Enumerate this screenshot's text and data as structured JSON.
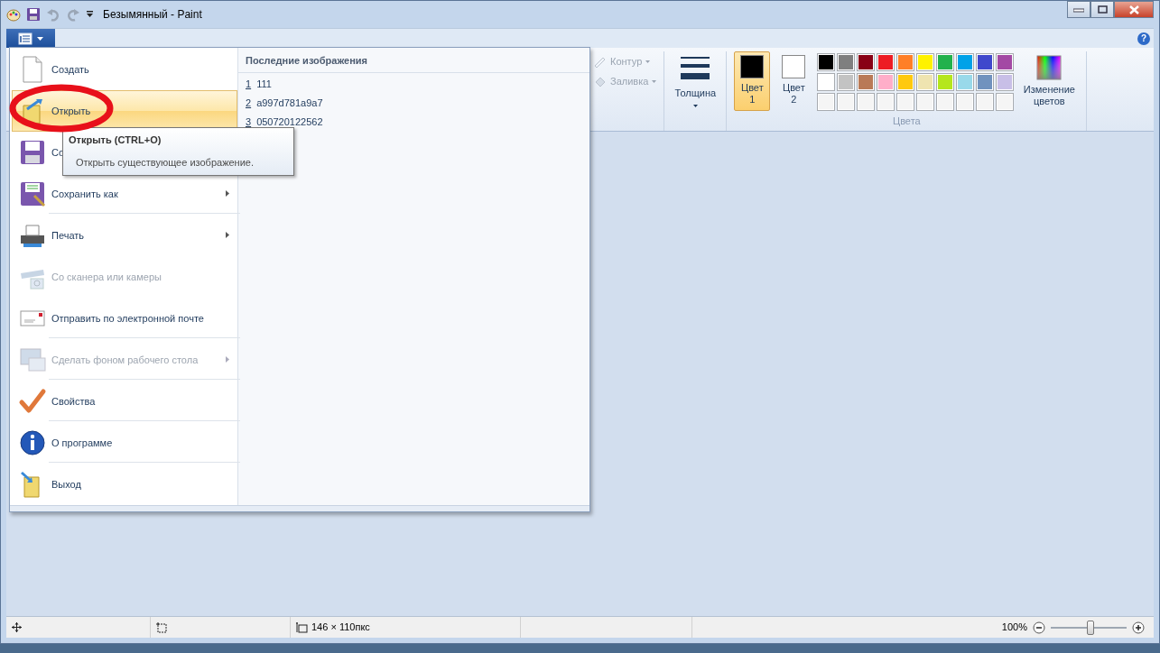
{
  "window": {
    "title": "Безымянный - Paint"
  },
  "app_menu": {
    "items": [
      {
        "label": "Создать",
        "selected": false,
        "disabled": false,
        "submenu": false,
        "separator_after": false
      },
      {
        "label": "Открыть",
        "selected": true,
        "disabled": false,
        "submenu": false,
        "separator_after": false
      },
      {
        "label": "Со",
        "selected": false,
        "disabled": false,
        "separator_after": false
      },
      {
        "label": "Сохранить как",
        "selected": false,
        "disabled": false,
        "submenu": true,
        "separator_after": true
      },
      {
        "label": "Печать",
        "selected": false,
        "disabled": false,
        "submenu": true,
        "separator_after": false
      },
      {
        "label": "Со сканера или камеры",
        "selected": false,
        "disabled": true,
        "submenu": false,
        "separator_after": false
      },
      {
        "label": "Отправить по электронной почте",
        "selected": false,
        "disabled": false,
        "submenu": false,
        "separator_after": true
      },
      {
        "label": "Сделать фоном рабочего стола",
        "selected": false,
        "disabled": true,
        "submenu": true,
        "separator_after": true
      },
      {
        "label": "Свойства",
        "selected": false,
        "disabled": false,
        "submenu": false,
        "separator_after": true
      },
      {
        "label": "О программе",
        "selected": false,
        "disabled": false,
        "submenu": false,
        "separator_after": true
      },
      {
        "label": "Выход",
        "selected": false,
        "disabled": false,
        "submenu": false,
        "separator_after": false
      }
    ],
    "recent": {
      "title": "Последние изображения",
      "items": [
        {
          "number": "1",
          "name": "111"
        },
        {
          "number": "2",
          "name": "a997d781a9a7"
        },
        {
          "number": "3",
          "name": "050720122562"
        }
      ]
    }
  },
  "tooltip": {
    "title": "Открыть (CTRL+O)",
    "text": "Открыть существующее изображение."
  },
  "ribbon": {
    "outline": {
      "label": "Контур",
      "disabled": true
    },
    "fill": {
      "label": "Заливка",
      "disabled": true
    },
    "size": {
      "label": "Толщина"
    },
    "color_slots": [
      {
        "label": "Цвет",
        "number": "1",
        "color": "#000000",
        "selected": true
      },
      {
        "label": "Цвет",
        "number": "2",
        "color": "#ffffff",
        "selected": false
      }
    ],
    "palette": [
      [
        {
          "color": "#000000"
        },
        {
          "color": "#7f7f7f"
        },
        {
          "color": "#880015"
        },
        {
          "color": "#ed1c24"
        },
        {
          "color": "#ff7f27"
        },
        {
          "color": "#fff200"
        },
        {
          "color": "#22b14c"
        },
        {
          "color": "#00a2e8"
        },
        {
          "color": "#3f48cc"
        },
        {
          "color": "#a349a4"
        }
      ],
      [
        {
          "color": "#ffffff"
        },
        {
          "color": "#c3c3c3"
        },
        {
          "color": "#b97a57"
        },
        {
          "color": "#ffaec9"
        },
        {
          "color": "#ffc90e"
        },
        {
          "color": "#efe4b0"
        },
        {
          "color": "#b5e61d"
        },
        {
          "color": "#99d9ea"
        },
        {
          "color": "#7092be"
        },
        {
          "color": "#c8bfe7"
        }
      ],
      [
        {
          "color": "#f5f5f5"
        },
        {
          "color": "#f5f5f5"
        },
        {
          "color": "#f5f5f5"
        },
        {
          "color": "#f5f5f5"
        },
        {
          "color": "#f5f5f5"
        },
        {
          "color": "#f5f5f5"
        },
        {
          "color": "#f5f5f5"
        },
        {
          "color": "#f5f5f5"
        },
        {
          "color": "#f5f5f5"
        },
        {
          "color": "#f5f5f5"
        }
      ]
    ],
    "edit_colors": {
      "label": "Изменение цветов"
    },
    "group_label": "Цвета",
    "help": "?"
  },
  "status_bar": {
    "size": "146 × 110пкс",
    "zoom": "100%",
    "zoom_slider": {
      "level": 0.52
    }
  }
}
